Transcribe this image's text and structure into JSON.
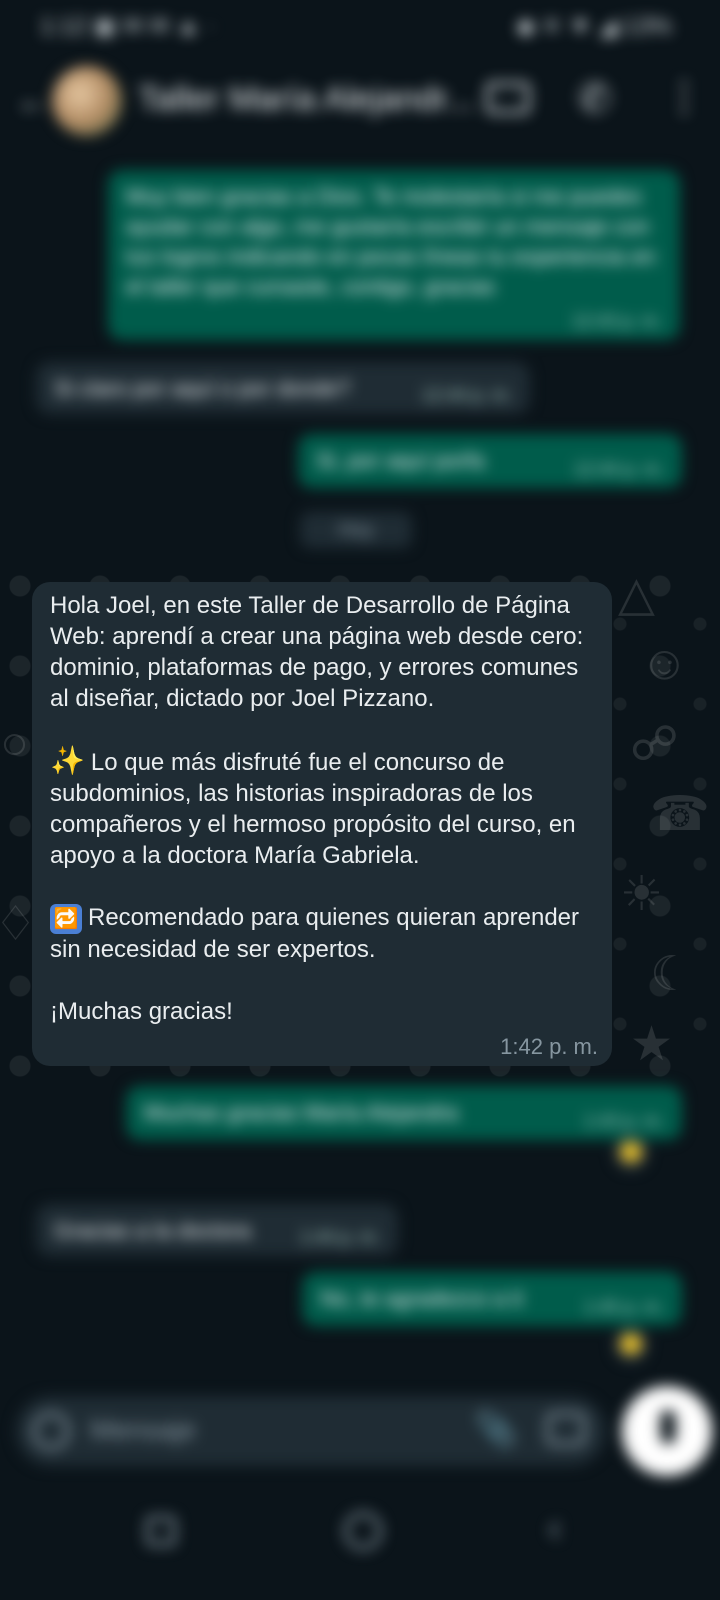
{
  "status_bar": {
    "left": "1:12 ▣ ✉ ✉ ▲ ·",
    "right": "◆ ✕ ▼ ◢ 13%"
  },
  "header": {
    "title": "Taller María Alejandr...",
    "icons": [
      "back-icon",
      "avatar",
      "video-call-icon",
      "phone-icon",
      "more-options-icon"
    ]
  },
  "messages_blurred": [
    {
      "dir": "out",
      "text": "Muy bien gracias a Dios. Te molestaría si me puedes ayudar con algo, me gustaría escribir un mensaje con tus logros indicando en pocas líneas tu experiencia en el taller que cursaste, contigo, gracias",
      "time": "12:43 p. m."
    },
    {
      "dir": "in",
      "text": "Si claro por aquí o por donde?",
      "time": "12:44 p. m."
    },
    {
      "dir": "out",
      "text": "Si, por aquí porfa",
      "time": "12:44 p. m."
    },
    {
      "dir": "out",
      "text": "Muchas gracias María Alejandra",
      "time": "1:43 p. m."
    },
    {
      "dir": "in",
      "text": "Gracias a la doctora",
      "time": "1:44 p. m."
    },
    {
      "dir": "out",
      "text": "No, te agradezco a ti",
      "time": "1:45 p. m."
    }
  ],
  "date_chip": "Hoy",
  "main_message": {
    "para1": "Hola Joel, en este Taller de Desarrollo de Página Web: aprendí a crear una página web desde cero: dominio, plataformas de pago, y errores comunes al diseñar, dictado por Joel Pizzano.",
    "para2_emoji": "✨",
    "para2": "Lo que más disfruté fue el concurso de subdominios, las historias inspiradoras de los compañeros y el hermoso propósito del curso, en apoyo a la doctora María Gabriela.",
    "para3_emoji": "🔁",
    "para3": "Recomendado para quienes quieran aprender sin necesidad de ser expertos.",
    "closing": "¡Muchas gracias!",
    "time": "1:42 p. m."
  },
  "input_bar": {
    "placeholder": "Mensaje"
  },
  "icons": {
    "emoji": "emoji-icon",
    "attach": "paperclip-icon",
    "camera": "camera-icon",
    "mic": "microphone-icon",
    "nav_recent": "recent-apps-icon",
    "nav_home": "home-icon",
    "nav_back": "back-nav-icon"
  },
  "colors": {
    "background": "#0b141a",
    "bubble_in": "#1f2c34",
    "bubble_out": "#005c4b",
    "text": "#e9edef"
  }
}
